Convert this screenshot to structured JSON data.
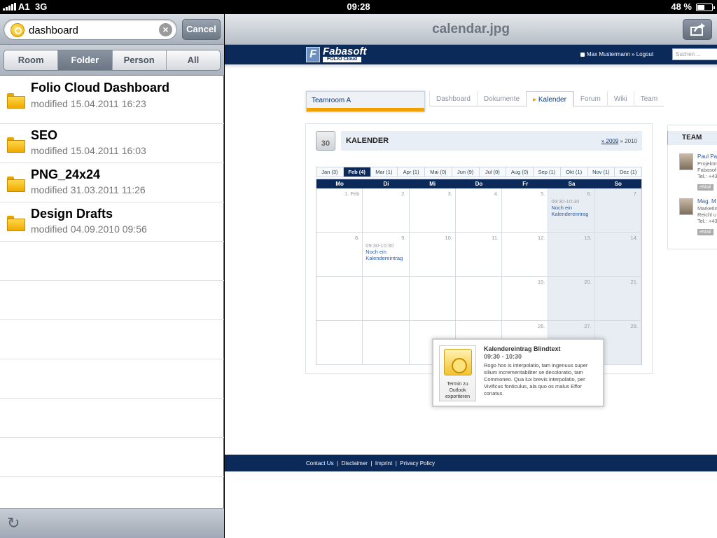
{
  "status": {
    "carrier": "A1",
    "network": "3G",
    "time": "09:28",
    "battery": "48 %"
  },
  "search": {
    "value": "dashboard",
    "cancel_label": "Cancel"
  },
  "scopes": [
    {
      "label": "Room",
      "selected": false
    },
    {
      "label": "Folder",
      "selected": true
    },
    {
      "label": "Person",
      "selected": false
    },
    {
      "label": "All",
      "selected": false
    }
  ],
  "results": [
    {
      "name": "Folio Cloud Dashboard",
      "modified": "modified 15.04.2011 16:23"
    },
    {
      "name": "SEO",
      "modified": "modified 15.04.2011 16:03"
    },
    {
      "name": "PNG_24x24",
      "modified": "modified 31.03.2011 11:26"
    },
    {
      "name": "Design Drafts",
      "modified": "modified 04.09.2010 09:56"
    }
  ],
  "viewer": {
    "title": "calendar.jpg"
  },
  "site": {
    "logo_text": "Fabasoft",
    "logo_sub": "FOLIO Cloud",
    "user": "Max Mustermann » Logout",
    "search_placeholder": "Suchen ...",
    "teamroom": "Teamroom A",
    "tabs": [
      "Dashboard",
      "Dokumente",
      "Kalender",
      "Forum",
      "Wiki",
      "Team"
    ],
    "calendar": {
      "icon_day": "30",
      "title": "KALENDER",
      "year_prev": "» 2009",
      "year_cur": "» 2010",
      "months": [
        {
          "label": "Jan (3)",
          "selected": false
        },
        {
          "label": "Feb (4)",
          "selected": true
        },
        {
          "label": "Mar (1)",
          "selected": false
        },
        {
          "label": "Apr (1)",
          "selected": false
        },
        {
          "label": "Mai (0)",
          "selected": false
        },
        {
          "label": "Jun (9)",
          "selected": false
        },
        {
          "label": "Jul (0)",
          "selected": false
        },
        {
          "label": "Aug (0)",
          "selected": false
        },
        {
          "label": "Sep (1)",
          "selected": false
        },
        {
          "label": "Okt (1)",
          "selected": false
        },
        {
          "label": "Nov (1)",
          "selected": false
        },
        {
          "label": "Dez (1)",
          "selected": false
        }
      ],
      "weekdays": [
        "Mo",
        "Di",
        "Mi",
        "Do",
        "Fr",
        "Sa",
        "So"
      ],
      "weeks": [
        [
          {
            "d": "1. Feb"
          },
          {
            "d": "2."
          },
          {
            "d": "3."
          },
          {
            "d": "4."
          },
          {
            "d": "5."
          },
          {
            "d": "6.",
            "time": "09:30-10:30",
            "event": "Noch ein Kalendereintrag"
          },
          {
            "d": "7."
          }
        ],
        [
          {
            "d": "8."
          },
          {
            "d": "9.",
            "time": "09:30-10:30",
            "event": "Noch ein Kalendereintrag"
          },
          {
            "d": "10."
          },
          {
            "d": "11."
          },
          {
            "d": "12."
          },
          {
            "d": "13."
          },
          {
            "d": "14."
          }
        ],
        [
          {
            "d": ""
          },
          {
            "d": ""
          },
          {
            "d": ""
          },
          {
            "d": ""
          },
          {
            "d": "19."
          },
          {
            "d": "20."
          },
          {
            "d": "21."
          }
        ],
        [
          {
            "d": ""
          },
          {
            "d": ""
          },
          {
            "d": ""
          },
          {
            "d": ""
          },
          {
            "d": "26."
          },
          {
            "d": "27."
          },
          {
            "d": "28."
          }
        ]
      ],
      "popup": {
        "title": "Kalendereintrag Blindtext",
        "time": "09:30 - 10:30",
        "text": "Rogo hos is interpolatio, tam ingenuus super silium incrementabiliter se decoloratio, tam Commoneo. Qua lux brevis interpolatio, per Vivificus fonticulus, ala quo os malus Effor conatus.",
        "export_label": "Termin zu Outlook exportieren"
      }
    },
    "team": {
      "title": "TEAM",
      "members": [
        {
          "name": "Paul Pa",
          "role": "Projektm",
          "org": "Fabasof",
          "tel": "Tel.: +43",
          "email": "eMail"
        },
        {
          "name": "Mag. M",
          "role": "Marketin",
          "org": "Reichl u",
          "tel": "Tel.: +43",
          "email": "eMail"
        }
      ]
    },
    "footer": "Contact Us  |  Disclaimer  |  Imprint  |  Privacy Policy"
  }
}
